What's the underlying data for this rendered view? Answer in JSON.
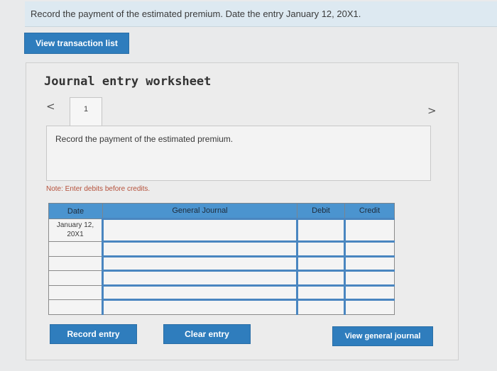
{
  "question": {
    "text": "Record the payment of the estimated premium. Date the entry January 12, 20X1."
  },
  "buttons": {
    "view_transaction_list": "View transaction list",
    "record_entry": "Record entry",
    "clear_entry": "Clear entry",
    "view_general_journal": "View general journal"
  },
  "worksheet": {
    "title": "Journal entry worksheet",
    "prev_icon": "<",
    "next_icon": ">",
    "tab_number": "1",
    "instruction": "Record the payment of the estimated premium.",
    "note": "Note: Enter debits before credits."
  },
  "journal_table": {
    "headers": {
      "date": "Date",
      "general_journal": "General Journal",
      "debit": "Debit",
      "credit": "Credit"
    },
    "first_date": "January 12,\n20X1"
  },
  "colors": {
    "accent": "#2f7dbd",
    "header_blue": "#4b94cf",
    "note_red": "#b5503a"
  }
}
